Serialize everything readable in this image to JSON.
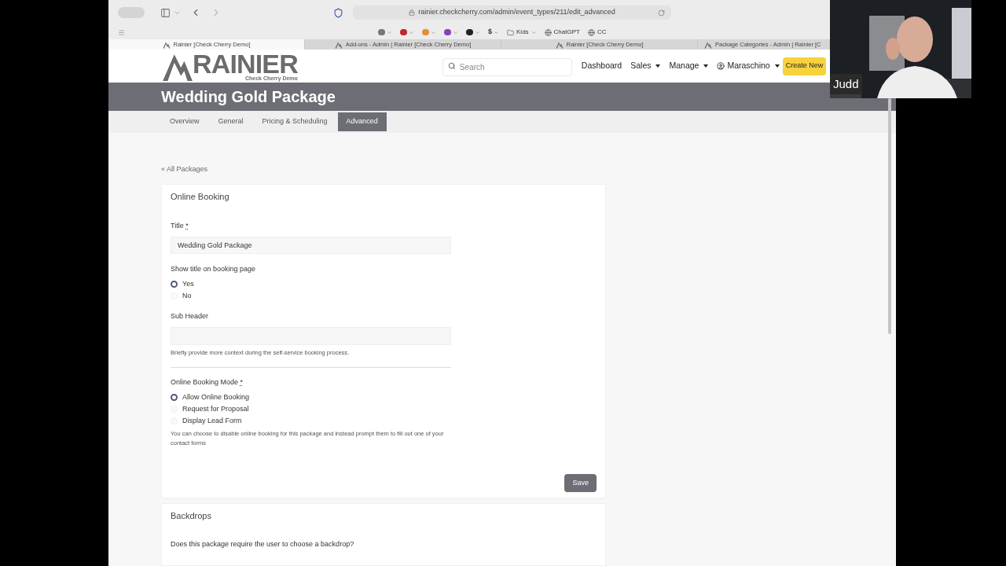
{
  "browser": {
    "url": "rainier.checkcherry.com/admin/event_types/211/edit_advanced",
    "bookmarks": [
      {
        "kind": "icon"
      },
      {
        "kind": "icon"
      },
      {
        "kind": "icon"
      },
      {
        "kind": "icon"
      },
      {
        "kind": "icon"
      },
      {
        "kind": "text",
        "label": "$"
      },
      {
        "kind": "folder",
        "label": "Kids"
      },
      {
        "kind": "globe",
        "label": "ChatGPT"
      },
      {
        "kind": "globe",
        "label": "CC"
      }
    ],
    "tabs": [
      {
        "label": "Rainier [Check Cherry Demo]",
        "selected": true
      },
      {
        "label": "Add-ons - Admin | Rainier [Check Cherry Demo]",
        "selected": false
      },
      {
        "label": "Rainier [Check Cherry Demo]",
        "selected": false
      },
      {
        "label": "Package Categories - Admin | Rainier [C",
        "selected": false
      }
    ]
  },
  "site": {
    "logo": {
      "name": "RAINIER",
      "subtitle": "Check Cherry Demo"
    },
    "search": {
      "placeholder": "Search"
    },
    "nav": [
      {
        "label": "Dashboard",
        "dropdown": false,
        "user": false
      },
      {
        "label": "Sales",
        "dropdown": true,
        "user": false
      },
      {
        "label": "Manage",
        "dropdown": true,
        "user": false
      },
      {
        "label": "Maraschino",
        "dropdown": true,
        "user": true
      }
    ],
    "create_button": "Create New"
  },
  "page_title": "Wedding Gold Package",
  "page_tabs": [
    {
      "label": "Overview",
      "selected": false
    },
    {
      "label": "General",
      "selected": false
    },
    {
      "label": "Pricing & Scheduling",
      "selected": false
    },
    {
      "label": "Advanced",
      "selected": true
    }
  ],
  "back_link": "« All Packages",
  "online_booking": {
    "heading": "Online Booking",
    "title_field": {
      "label": "Title",
      "required": "*",
      "value": "Wedding Gold Package"
    },
    "show_title": {
      "label": "Show title on booking page",
      "options": [
        {
          "label": "Yes",
          "selected": true
        },
        {
          "label": "No",
          "selected": false
        }
      ]
    },
    "sub_header": {
      "label": "Sub Header",
      "help": "Briefly provide more context during the self-service booking process."
    },
    "mode": {
      "label": "Online Booking Mode",
      "required": "*",
      "options": [
        {
          "label": "Allow Online Booking",
          "selected": true
        },
        {
          "label": "Request for Proposal",
          "selected": false
        },
        {
          "label": "Display Lead Form",
          "selected": false
        }
      ],
      "help": "You can choose to disable online booking for this package and instead prompt them to fill out one of your contact forms"
    },
    "save": "Save"
  },
  "backdrops": {
    "heading": "Backdrops",
    "question": "Does this package require the user to choose a backdrop?"
  },
  "video": {
    "kind": "picture",
    "name": "Judd"
  }
}
